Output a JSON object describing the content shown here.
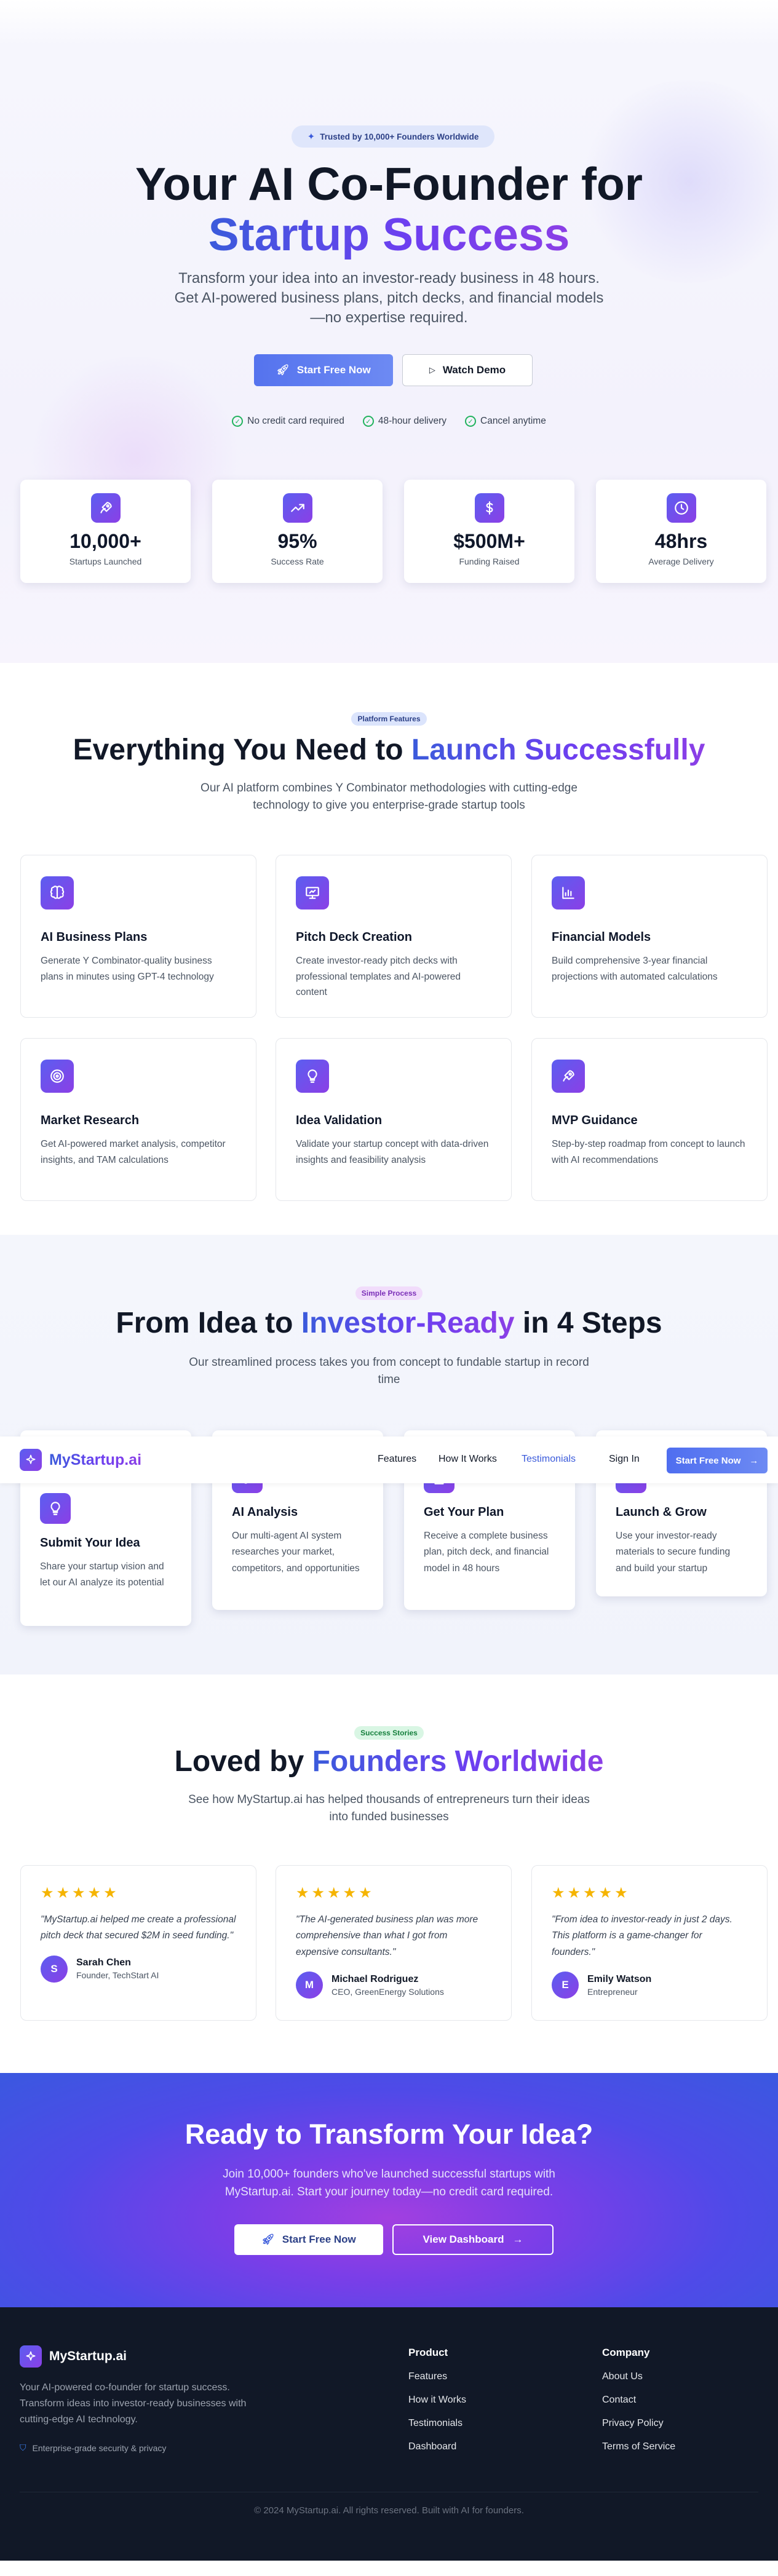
{
  "hero": {
    "trust_badge": "Trusted by 10,000+ Founders Worldwide",
    "title_line1": "Your AI Co-Founder for",
    "title_line2": "Startup Success",
    "subtitle_line1": "Transform your idea into an investor-ready business in 48 hours.",
    "subtitle_line2": "Get AI-powered business plans, pitch decks, and financial models",
    "subtitle_line3": "—no expertise required.",
    "primary_cta": "Start Free Now",
    "secondary_cta": "Watch Demo",
    "checks": [
      "No credit card required",
      "48-hour delivery",
      "Cancel anytime"
    ]
  },
  "stats": [
    {
      "icon": "rocket-icon",
      "value": "10,000+",
      "label": "Startups Launched"
    },
    {
      "icon": "trending-up-icon",
      "value": "95%",
      "label": "Success Rate"
    },
    {
      "icon": "dollar-icon",
      "value": "$500M+",
      "label": "Funding Raised"
    },
    {
      "icon": "clock-icon",
      "value": "48hrs",
      "label": "Average Delivery"
    }
  ],
  "features": {
    "badge": "Platform Features",
    "title_plain": "Everything You Need to",
    "title_grad": "Launch Successfully",
    "subtitle_line1": "Our AI platform combines Y Combinator methodologies with cutting-edge",
    "subtitle_line2": "technology to give you enterprise-grade startup tools",
    "items": [
      {
        "icon": "brain-icon",
        "title": "AI Business Plans",
        "desc": "Generate Y Combinator-quality business plans in minutes using GPT-4 technology"
      },
      {
        "icon": "presentation-icon",
        "title": "Pitch Deck Creation",
        "desc": "Create investor-ready pitch decks with professional templates and AI-powered content"
      },
      {
        "icon": "bar-chart-icon",
        "title": "Financial Models",
        "desc": "Build comprehensive 3-year financial projections with automated calculations"
      },
      {
        "icon": "target-icon",
        "title": "Market Research",
        "desc": "Get AI-powered market analysis, competitor insights, and TAM calculations"
      },
      {
        "icon": "lightbulb-icon",
        "title": "Idea Validation",
        "desc": "Validate your startup concept with data-driven insights and feasibility analysis"
      },
      {
        "icon": "rocket-icon",
        "title": "MVP Guidance",
        "desc": "Step-by-step roadmap from concept to launch with AI recommendations"
      }
    ]
  },
  "process": {
    "badge": "Simple Process",
    "title_plain1": "From Idea to",
    "title_grad": "Investor-Ready",
    "title_plain2": "in 4 Steps",
    "subtitle_line1": "Our streamlined process takes you from concept to fundable startup in record",
    "subtitle_line2": "time",
    "steps": [
      {
        "icon": "lightbulb-icon",
        "title": "Submit Your Idea",
        "desc": "Share your startup vision and let our AI analyze its potential"
      },
      {
        "icon": "brain-icon",
        "title": "AI Analysis",
        "desc": "Our multi-agent AI system researches your market, competitors, and opportunities"
      },
      {
        "icon": "file-icon",
        "title": "Get Your Plan",
        "desc": "Receive a complete business plan, pitch deck, and financial model in 48 hours"
      },
      {
        "icon": "rocket-icon",
        "title": "Launch & Grow",
        "desc": "Use your investor-ready materials to secure funding and build your startup"
      }
    ]
  },
  "navbar": {
    "brand": "MyStartup.ai",
    "links": [
      "Features",
      "How It Works",
      "Testimonials"
    ],
    "sign_in": "Sign In",
    "cta": "Start Free Now"
  },
  "testimonials": {
    "badge": "Success Stories",
    "title_plain": "Loved by",
    "title_grad": "Founders Worldwide",
    "subtitle_line1": "See how MyStartup.ai has helped thousands of entrepreneurs turn their ideas",
    "subtitle_line2": "into funded businesses",
    "stars": "★★★★★",
    "items": [
      {
        "quote": "\"MyStartup.ai helped me create a professional pitch deck that secured $2M in seed funding.\"",
        "initial": "S",
        "name": "Sarah Chen",
        "role": "Founder, TechStart AI"
      },
      {
        "quote": "\"The AI-generated business plan was more comprehensive than what I got from expensive consultants.\"",
        "initial": "M",
        "name": "Michael Rodriguez",
        "role": "CEO, GreenEnergy Solutions"
      },
      {
        "quote": "\"From idea to investor-ready in just 2 days. This platform is a game-changer for founders.\"",
        "initial": "E",
        "name": "Emily Watson",
        "role": "Entrepreneur"
      }
    ]
  },
  "cta_section": {
    "title": "Ready to Transform Your Idea?",
    "subtitle_line1": "Join 10,000+ founders who've launched successful startups with",
    "subtitle_line2": "MyStartup.ai. Start your journey today—no credit card required.",
    "primary": "Start Free Now",
    "secondary": "View Dashboard"
  },
  "footer": {
    "brand": "MyStartup.ai",
    "desc_line1": "Your AI-powered co-founder for startup success.",
    "desc_line2": "Transform ideas into investor-ready businesses with",
    "desc_line3": "cutting-edge AI technology.",
    "security": "Enterprise-grade security & privacy",
    "product_heading": "Product",
    "product_links": [
      "Features",
      "How it Works",
      "Testimonials",
      "Dashboard"
    ],
    "company_heading": "Company",
    "company_links": [
      "About Us",
      "Contact",
      "Privacy Policy",
      "Terms of Service"
    ],
    "copyright": "© 2024 MyStartup.ai. All rights reserved. Built with AI for founders."
  },
  "colors": {
    "primary_blue": "#3b5bdb",
    "accent_purple": "#8b3fe6",
    "footer_bg": "#111827"
  }
}
